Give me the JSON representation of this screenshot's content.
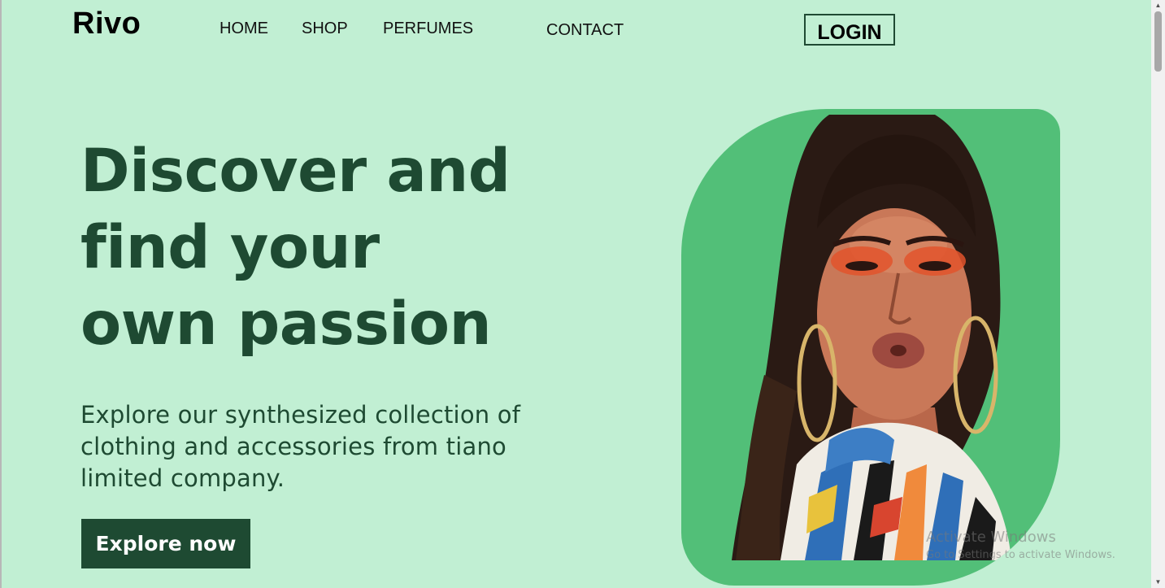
{
  "brand": {
    "logo": "Rivo"
  },
  "nav": {
    "home": "HOME",
    "shop": "SHOP",
    "perfumes": "PERFUMES",
    "contact": "CONTACT",
    "login": "LOGIN"
  },
  "hero": {
    "title_lines": [
      "Discover and",
      "find your",
      "own passion"
    ],
    "subtitle_lines": [
      "Explore our synthesized collection of",
      "clothing and accessories from tiano",
      "limited company."
    ],
    "cta_label": "Explore now"
  },
  "watermark": {
    "title": "Activate Windows",
    "subtitle": "Go to Settings to activate Windows."
  },
  "colors": {
    "background": "#c1efd3",
    "primary_dark": "#1e4a32",
    "card_green": "#52bf78"
  },
  "icons": {
    "scroll_up": "triangle-up-icon",
    "scroll_down": "triangle-down-icon"
  }
}
